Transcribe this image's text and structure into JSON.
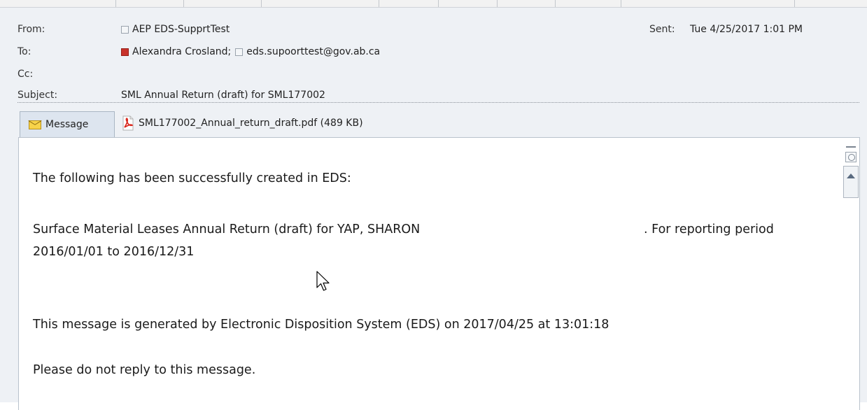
{
  "header": {
    "from_label": "From:",
    "from_value": "AEP EDS-SupprtTest",
    "to_label": "To:",
    "to_recipient1": "Alexandra Crosland;",
    "to_recipient2": "eds.supoorttest@gov.ab.ca",
    "cc_label": "Cc:",
    "subject_label": "Subject:",
    "subject_value": "SML Annual Return (draft) for SML177002",
    "sent_label": "Sent:",
    "sent_value": "Tue 4/25/2017 1:01 PM"
  },
  "attachments_bar": {
    "message_tab_label": "Message",
    "attachment_name": "SML177002_Annual_return_draft.pdf (489 KB)"
  },
  "body": {
    "line1": "The following has been successfully created in EDS:",
    "line2a": "Surface Material Leases Annual Return (draft) for YAP, SHARON",
    "line2b": ". For reporting period",
    "line3": "2016/01/01 to 2016/12/31",
    "line4": "This message is generated by Electronic Disposition System (EDS) on 2017/04/25 at 13:01:18",
    "line5": "Please do not reply to this message."
  },
  "colors": {
    "header_bg": "#eef1f5",
    "tab_bg": "#dde5ef",
    "pdf_red": "#d9261c",
    "contact_red": "#c8322b"
  },
  "icons": {
    "contact": "contact-card-icon",
    "envelope": "envelope-icon",
    "pdf": "pdf-icon",
    "cursor": "mouse-pointer-icon"
  }
}
